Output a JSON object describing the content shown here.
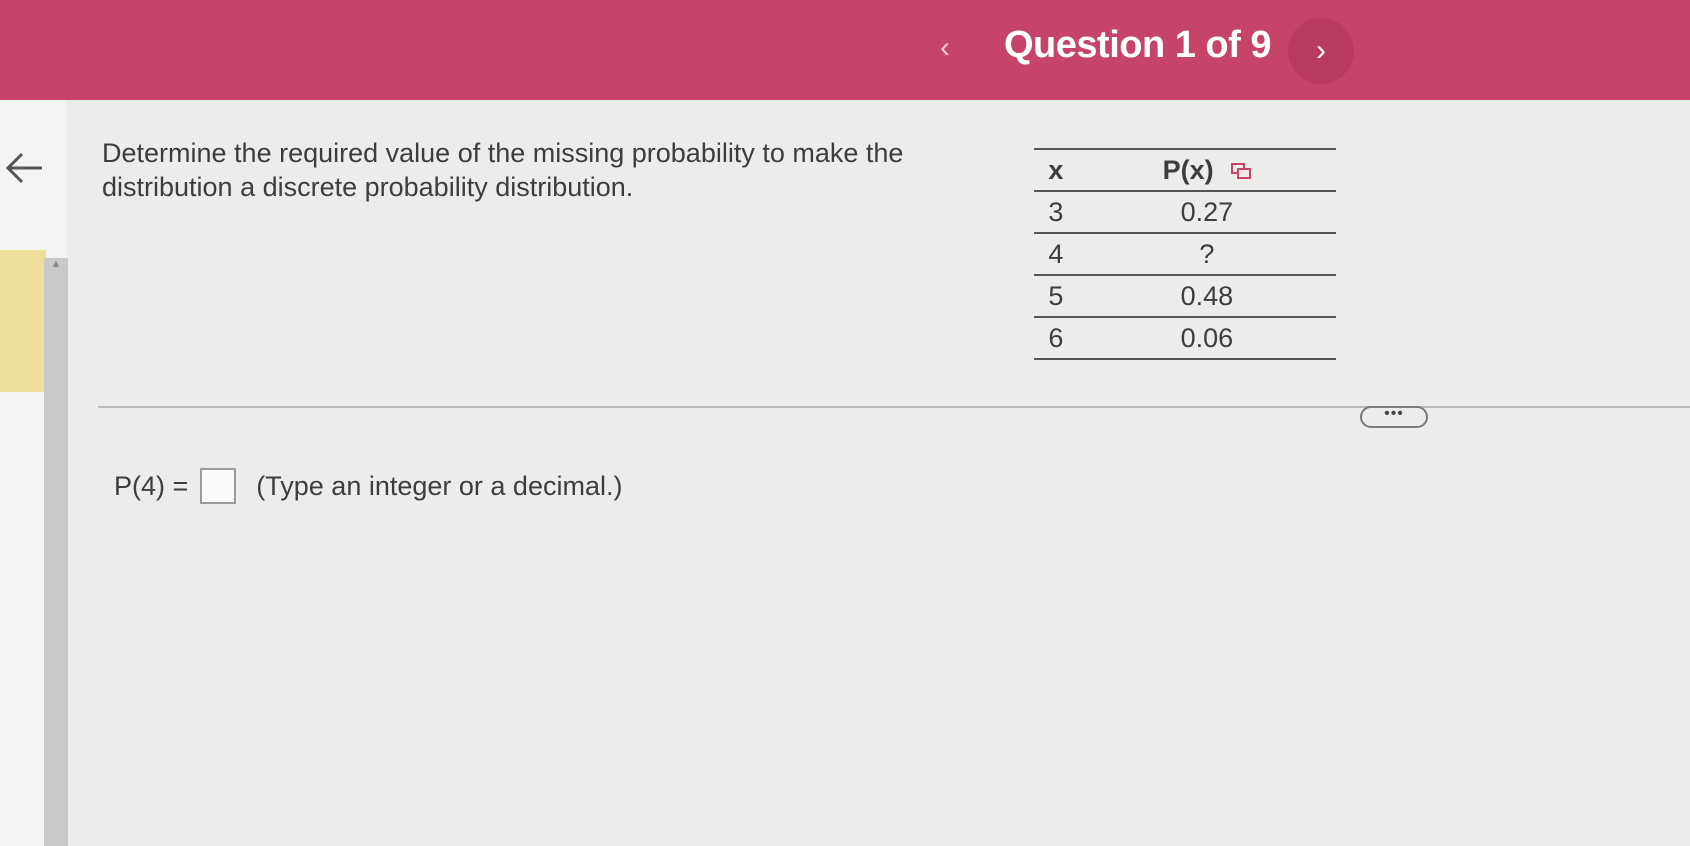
{
  "header": {
    "title": "Question 1 of 9",
    "prev_glyph": "‹",
    "next_glyph": "›"
  },
  "question": {
    "text": "Determine the required value of the missing probability to make the distribution a discrete probability distribution."
  },
  "table": {
    "headers": [
      "x",
      "P(x)"
    ],
    "rows": [
      [
        "3",
        "0.27"
      ],
      [
        "4",
        "?"
      ],
      [
        "5",
        "0.48"
      ],
      [
        "6",
        "0.06"
      ]
    ]
  },
  "more_button": {
    "label": "•••"
  },
  "answer": {
    "prefix": "P(4) =",
    "value": "",
    "hint": "(Type an integer or a decimal.)"
  },
  "colors": {
    "header_bg": "#c64469",
    "next_button_bg": "#b93b60",
    "side_tab": "#efdf9c"
  },
  "icons": {
    "back": "arrow-left-icon",
    "copy": "copy-icon",
    "scroll_up": "triangle-up-icon"
  }
}
